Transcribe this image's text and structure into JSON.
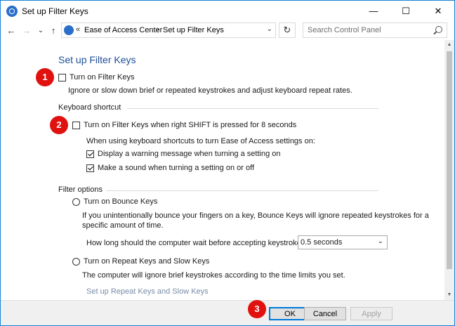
{
  "window": {
    "title": "Set up Filter Keys",
    "minimize": "—",
    "maximize": "☐",
    "close": "✕"
  },
  "nav": {
    "back": "←",
    "forward": "→",
    "recent": "⌄",
    "up": "↑",
    "breadcrumb_overflow": "«",
    "breadcrumb": [
      "Ease of Access Center",
      "Set up Filter Keys"
    ],
    "breadcrumb_sep": "›",
    "dropdown": "⌄",
    "refresh": "↻",
    "search_placeholder": "Search Control Panel"
  },
  "page": {
    "heading": "Set up Filter Keys",
    "turn_on": {
      "label": "Turn on Filter Keys",
      "checked": false
    },
    "turn_on_desc": "Ignore or slow down brief or repeated keystrokes and adjust keyboard repeat rates.",
    "keyboard_shortcut": {
      "title": "Keyboard shortcut",
      "shortcut_option": {
        "label": "Turn on Filter Keys when right SHIFT is pressed for 8 seconds",
        "checked": false
      },
      "sub_intro": "When using keyboard shortcuts to turn Ease of Access settings on:",
      "warning_option": {
        "label": "Display a warning message when turning a setting on",
        "checked": true
      },
      "sound_option": {
        "label": "Make a sound when turning a setting on or off",
        "checked": true
      }
    },
    "filter_options": {
      "title": "Filter options",
      "bounce": {
        "label": "Turn on Bounce Keys",
        "desc_line1": "If you unintentionally bounce your fingers on a key, Bounce Keys will ignore repeated keystrokes for a",
        "desc_line2": "specific amount of time.",
        "wait_label": "How long should the computer wait before accepting keystrokes?",
        "wait_value": "0.5 seconds"
      },
      "repeat_slow": {
        "label": "Turn on Repeat Keys and Slow Keys",
        "desc": "The computer will ignore brief keystrokes according to the time limits you set.",
        "setup_link": "Set up Repeat Keys and Slow Keys"
      }
    }
  },
  "badges": [
    "1",
    "2",
    "3"
  ],
  "footer": {
    "ok": "OK",
    "cancel": "Cancel",
    "apply": "Apply"
  },
  "colors": {
    "heading": "#1e4e97",
    "badge": "#e0110e",
    "window_border": "#1883d7"
  }
}
